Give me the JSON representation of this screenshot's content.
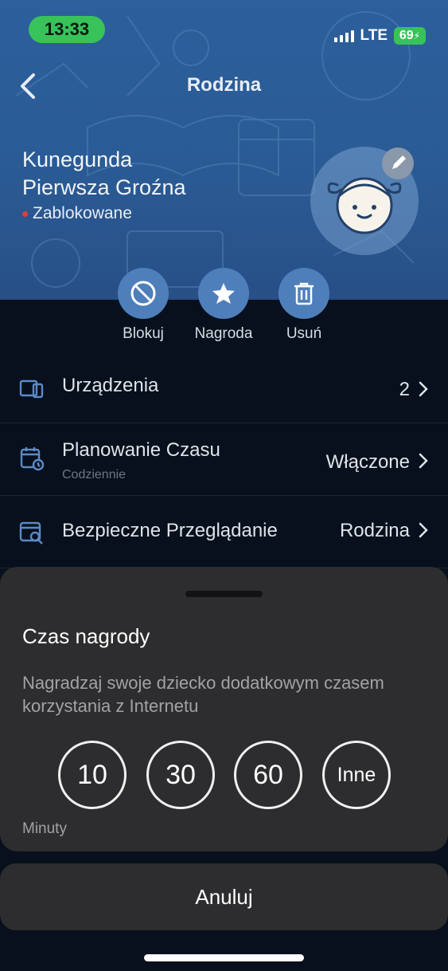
{
  "status_bar": {
    "time": "13:33",
    "network": "LTE",
    "battery": "69"
  },
  "header": {
    "title": "Rodzina"
  },
  "profile": {
    "name_line1": "Kunegunda",
    "name_line2": "Pierwsza Groźna",
    "status": "Zablokowane"
  },
  "actions": [
    {
      "label": "Blokuj",
      "icon": "block-icon"
    },
    {
      "label": "Nagroda",
      "icon": "star-icon"
    },
    {
      "label": "Usuń",
      "icon": "trash-icon"
    }
  ],
  "menu": [
    {
      "title": "Urządzenia",
      "value": "2",
      "icon": "devices-icon"
    },
    {
      "title": "Planowanie Czasu",
      "subtitle": "Codziennie",
      "value": "Włączone",
      "icon": "calendar-clock-icon"
    },
    {
      "title": "Bezpieczne Przeglądanie",
      "value": "Rodzina",
      "icon": "safe-browsing-icon"
    }
  ],
  "reward_sheet": {
    "title": "Czas nagrody",
    "description": "Nagradzaj swoje dziecko dodatkowym czasem korzystania z Internetu",
    "options": [
      "10",
      "30",
      "60",
      "Inne"
    ],
    "units": "Minuty"
  },
  "cancel_label": "Anuluj",
  "colors": {
    "hero_blue": "#2c5f9c",
    "action_blue": "#4f7fba",
    "status_green": "#37c35a",
    "sheet_bg": "#2d2d2f"
  }
}
